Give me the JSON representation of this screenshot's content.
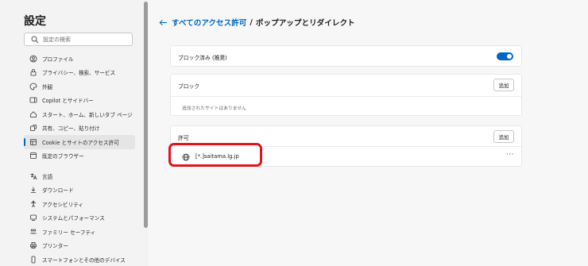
{
  "sidebar": {
    "title": "設定",
    "search_placeholder": "設定の検索",
    "items": [
      {
        "label": "プロファイル",
        "icon": "profile-icon"
      },
      {
        "label": "プライバシー、検索、サービス",
        "icon": "lock-icon"
      },
      {
        "label": "外観",
        "icon": "palette-icon"
      },
      {
        "label": "Copilot とサイドバー",
        "icon": "sidebar-icon"
      },
      {
        "label": "スタート、ホーム、新しいタブ ページ",
        "icon": "home-icon"
      },
      {
        "label": "共有、コピー、貼り付け",
        "icon": "share-icon"
      },
      {
        "label": "Cookie とサイトのアクセス許可",
        "icon": "cookie-icon",
        "active": true
      },
      {
        "label": "既定のブラウザー",
        "icon": "browser-icon"
      }
    ],
    "items2": [
      {
        "label": "言語",
        "icon": "language-icon"
      },
      {
        "label": "ダウンロード",
        "icon": "download-icon"
      },
      {
        "label": "アクセシビリティ",
        "icon": "accessibility-icon"
      },
      {
        "label": "システムとパフォーマンス",
        "icon": "system-icon"
      },
      {
        "label": "ファミリー セーフティ",
        "icon": "family-icon"
      },
      {
        "label": "プリンター",
        "icon": "printer-icon"
      },
      {
        "label": "スマートフォンとその他のデバイス",
        "icon": "phone-icon"
      }
    ]
  },
  "header": {
    "back_icon": "back-arrow-icon",
    "breadcrumb_link": "すべてのアクセス許可",
    "separator": "/",
    "page_title": "ポップアップとリダイレクト"
  },
  "blocked_setting": {
    "label": "ブロック済み (推奨)",
    "enabled": true
  },
  "block_section": {
    "title": "ブロック",
    "add_label": "追加",
    "empty_text": "追加されたサイトはありません"
  },
  "allow_section": {
    "title": "許可",
    "add_label": "追加",
    "sites": [
      {
        "url": "[*.]saitama.lg.jp",
        "icon": "globe-icon",
        "more_label": "···"
      }
    ]
  },
  "colors": {
    "accent": "#0067c0",
    "highlight": "#e0141e"
  }
}
